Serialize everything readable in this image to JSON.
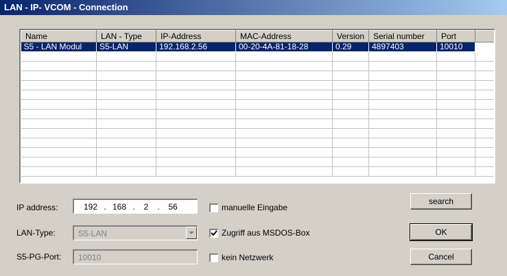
{
  "window": {
    "title": "LAN - IP- VCOM - Connection"
  },
  "list": {
    "columns": [
      "Name",
      "LAN - Type",
      "IP-Address",
      "MAC-Address",
      "Version",
      "Serial number",
      "Port"
    ],
    "rows": [
      {
        "name": "S5 - LAN Modul",
        "lan_type": "S5-LAN",
        "ip": "192.168.2.56",
        "mac": "00-20-4A-81-18-28",
        "version": "0.29",
        "serial": "4897403",
        "port": "10010"
      }
    ]
  },
  "form": {
    "ip_label": "IP address:",
    "ip_octets": [
      "192",
      "168",
      "2",
      "56"
    ],
    "ip_sep": ".",
    "lan_type_label": "LAN-Type:",
    "lan_type_value": "S5-LAN",
    "pg_port_label": "S5-PG-Port:",
    "pg_port_value": "10010"
  },
  "checks": {
    "manual_label": "manuelle Eingabe",
    "manual_checked": false,
    "msdos_label": "Zugriff aus MSDOS-Box",
    "msdos_checked": true,
    "nonet_label": "kein Netzwerk",
    "nonet_checked": false
  },
  "buttons": {
    "search": "search",
    "ok": "OK",
    "cancel": "Cancel"
  },
  "colors": {
    "title_start": "#0a246a",
    "title_end": "#a6caf0",
    "selection": "#0a246a",
    "face": "#d4d0c8"
  }
}
